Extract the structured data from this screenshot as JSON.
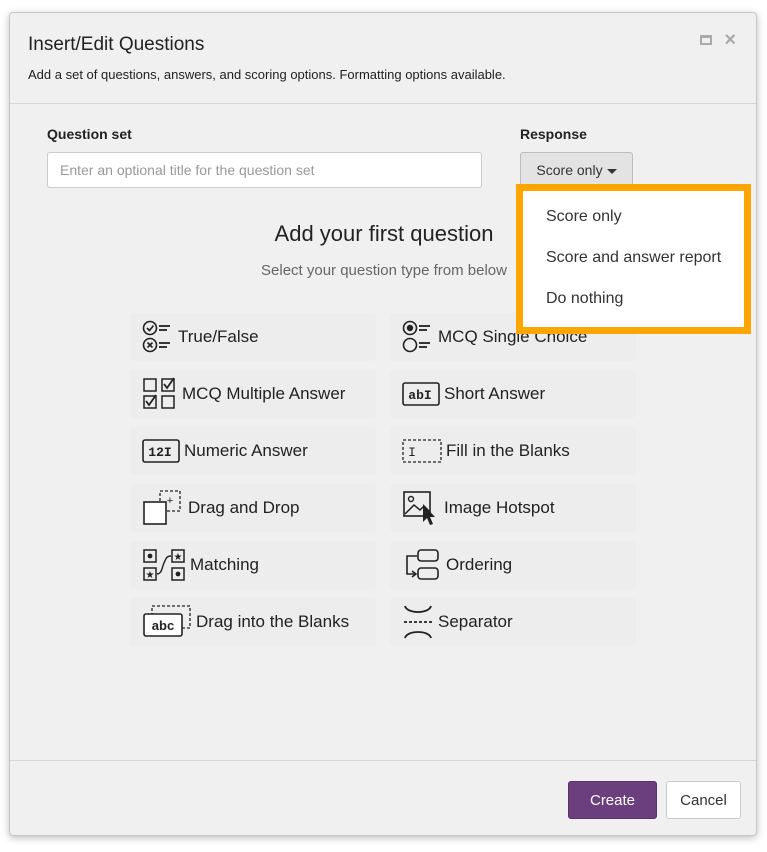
{
  "dialog": {
    "title": "Insert/Edit Questions",
    "subtitle": "Add a set of questions, answers, and scoring options. Formatting options available."
  },
  "form": {
    "question_set_label": "Question set",
    "question_set_placeholder": "Enter an optional title for the question set",
    "question_set_value": "",
    "response_label": "Response",
    "response_selected": "Score only"
  },
  "dropdown": {
    "options": [
      "Score only",
      "Score and answer report",
      "Do nothing"
    ],
    "highlight_color": "#ffa500"
  },
  "content": {
    "heading": "Add your first question",
    "subheading": "Select your question type from below"
  },
  "question_types": [
    {
      "label": "True/False",
      "icon": "true-false-icon"
    },
    {
      "label": "MCQ Single Choice",
      "icon": "mcq-single-choice-icon"
    },
    {
      "label": "MCQ Multiple Answer",
      "icon": "mcq-multiple-answer-icon"
    },
    {
      "label": "Short Answer",
      "icon": "short-answer-icon"
    },
    {
      "label": "Numeric Answer",
      "icon": "numeric-answer-icon"
    },
    {
      "label": "Fill in the Blanks",
      "icon": "fill-in-the-blanks-icon"
    },
    {
      "label": "Drag and Drop",
      "icon": "drag-and-drop-icon"
    },
    {
      "label": "Image Hotspot",
      "icon": "image-hotspot-icon"
    },
    {
      "label": "Matching",
      "icon": "matching-icon"
    },
    {
      "label": "Ordering",
      "icon": "ordering-icon"
    },
    {
      "label": "Drag into the Blanks",
      "icon": "drag-into-blanks-icon"
    },
    {
      "label": "Separator",
      "icon": "separator-icon"
    }
  ],
  "icon_text": {
    "short_answer": "abI",
    "numeric": "12I",
    "fill_blank": "I",
    "drag_blank": "abc"
  },
  "footer": {
    "create_label": "Create",
    "cancel_label": "Cancel",
    "create_color": "#6b3f7d"
  }
}
